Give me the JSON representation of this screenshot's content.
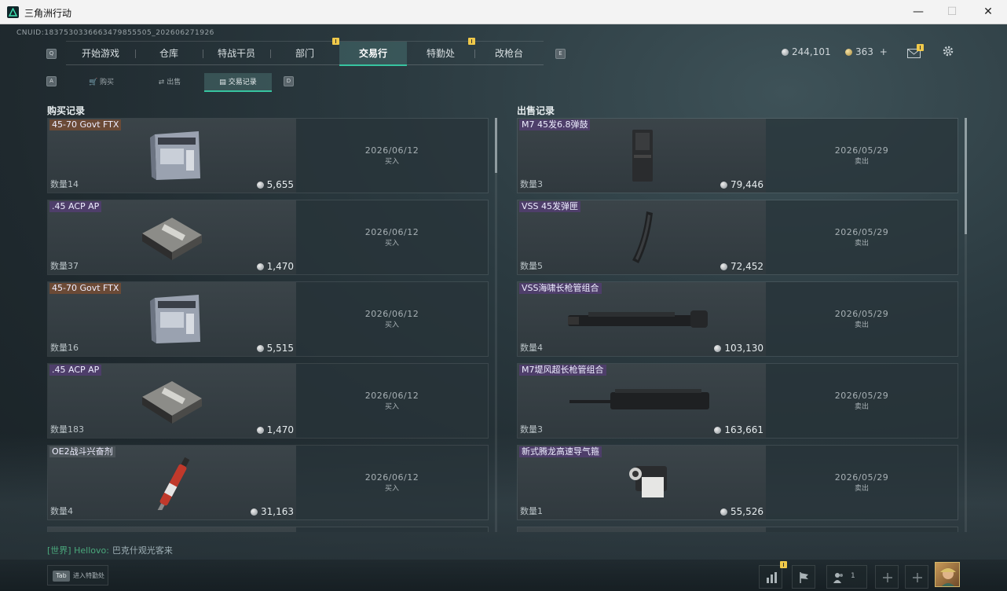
{
  "window": {
    "title": "三角洲行动",
    "minimize": "—",
    "maximize": "☐",
    "close": "✕"
  },
  "header": {
    "cnuid": "CNUID:1837530336663479855505_202606271926",
    "nav": {
      "left_key": "Q",
      "right_key": "E",
      "tabs": [
        {
          "label": "开始游戏",
          "active": false,
          "badge": false
        },
        {
          "label": "仓库",
          "active": false,
          "badge": false
        },
        {
          "label": "特战干员",
          "active": false,
          "badge": false
        },
        {
          "label": "部门",
          "active": false,
          "badge": true
        },
        {
          "label": "交易行",
          "active": true,
          "badge": false
        },
        {
          "label": "特勤处",
          "active": false,
          "badge": true
        },
        {
          "label": "改枪台",
          "active": false,
          "badge": false
        }
      ]
    },
    "currency": {
      "silver": "244,101",
      "gold": "363",
      "add": "+"
    },
    "icons": {
      "mail": "mail-icon",
      "settings": "gear-icon"
    }
  },
  "subtabs": {
    "left_key": "A",
    "right_key": "D",
    "items": [
      {
        "label": "购买",
        "icon": "cart-icon",
        "active": false
      },
      {
        "label": "出售",
        "icon": "sell-icon",
        "active": false
      },
      {
        "label": "交易记录",
        "icon": "record-icon",
        "active": true
      }
    ]
  },
  "purchase": {
    "title": "购买记录",
    "records": [
      {
        "name": "45-70 Govt FTX",
        "rarity": "orange",
        "qty": "数量14",
        "price": "5,655",
        "date": "2026/06/12",
        "action": "买入",
        "icon": "ammo-box-large-icon"
      },
      {
        "name": ".45 ACP AP",
        "rarity": "purple",
        "qty": "数量37",
        "price": "1,470",
        "date": "2026/06/12",
        "action": "买入",
        "icon": "ammo-box-small-icon"
      },
      {
        "name": "45-70 Govt FTX",
        "rarity": "orange",
        "qty": "数量16",
        "price": "5,515",
        "date": "2026/06/12",
        "action": "买入",
        "icon": "ammo-box-large-icon"
      },
      {
        "name": ".45 ACP AP",
        "rarity": "purple",
        "qty": "数量183",
        "price": "1,470",
        "date": "2026/06/12",
        "action": "买入",
        "icon": "ammo-box-small-icon"
      },
      {
        "name": "OE2战斗兴奋剂",
        "rarity": "gray",
        "qty": "数量4",
        "price": "31,163",
        "date": "2026/06/12",
        "action": "买入",
        "icon": "syringe-icon"
      }
    ]
  },
  "sales": {
    "title": "出售记录",
    "records": [
      {
        "name": "M7 45发6.8弹鼓",
        "rarity": "purple",
        "qty": "数量3",
        "price": "79,446",
        "date": "2026/05/29",
        "action": "卖出",
        "icon": "drum-magazine-icon"
      },
      {
        "name": "VSS 45发弹匣",
        "rarity": "purple",
        "qty": "数量5",
        "price": "72,452",
        "date": "2026/05/29",
        "action": "卖出",
        "icon": "curved-magazine-icon"
      },
      {
        "name": "VSS海啸长枪管组合",
        "rarity": "purple",
        "qty": "数量4",
        "price": "103,130",
        "date": "2026/05/29",
        "action": "卖出",
        "icon": "barrel-assembly-icon"
      },
      {
        "name": "M7堤风超长枪管组合",
        "rarity": "purple",
        "qty": "数量3",
        "price": "163,661",
        "date": "2026/05/29",
        "action": "卖出",
        "icon": "long-barrel-icon"
      },
      {
        "name": "新式腾龙高速导气箍",
        "rarity": "purple",
        "qty": "数量1",
        "price": "55,526",
        "date": "2026/05/29",
        "action": "卖出",
        "icon": "gas-block-icon"
      }
    ]
  },
  "chat": {
    "channel": "[世界]",
    "user": "Hellovo:",
    "message": "巴克什观光客来"
  },
  "bottom": {
    "tab_key": "Tab",
    "tab_label": "进入特勤处",
    "friends_count": "1"
  }
}
